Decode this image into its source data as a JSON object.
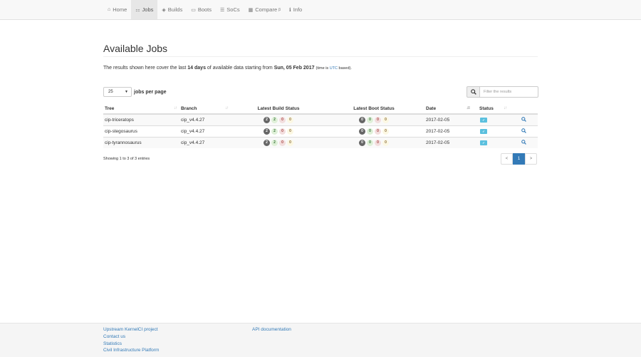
{
  "nav": {
    "items": [
      {
        "label": "Home",
        "icon": "home-icon",
        "glyph": "⌂",
        "active": false
      },
      {
        "label": "Jobs",
        "icon": "sitemap-icon",
        "glyph": "⚏",
        "active": true
      },
      {
        "label": "Builds",
        "icon": "cubes-icon",
        "glyph": "◈",
        "active": false
      },
      {
        "label": "Boots",
        "icon": "hdd-icon",
        "glyph": "▭",
        "active": false
      },
      {
        "label": "SoCs",
        "icon": "list-icon",
        "glyph": "☰",
        "active": false
      },
      {
        "label": "Compare",
        "icon": "grid-icon",
        "glyph": "▦",
        "active": false,
        "sup": "β"
      },
      {
        "label": "Info",
        "icon": "info-icon",
        "glyph": "ℹ",
        "active": false
      }
    ]
  },
  "page": {
    "title": "Available Jobs",
    "desc": {
      "p1": "The results shown here cover the last ",
      "days": "14 days",
      "p2": " of available data starting from ",
      "date": "Sun, 05 Feb 2017",
      "note_pre": "(time is ",
      "note_link": "UTC",
      "note_post": " based)."
    }
  },
  "controls": {
    "page_size": "25",
    "page_size_label": "jobs per page",
    "search_placeholder": "Filter the results"
  },
  "table": {
    "headers": {
      "tree": "Tree",
      "branch": "Branch",
      "build": "Latest Build Status",
      "boot": "Latest Boot Status",
      "date": "Date",
      "status": "Status"
    },
    "rows": [
      {
        "tree": "cip-triceratops",
        "branch": "cip_v4.4.27",
        "build": [
          "2",
          "2",
          "0",
          "0"
        ],
        "boot": [
          "0",
          "0",
          "0",
          "0"
        ],
        "date": "2017-02-05",
        "status": "✓"
      },
      {
        "tree": "cip-stegosaurus",
        "branch": "cip_v4.4.27",
        "build": [
          "2",
          "2",
          "0",
          "0"
        ],
        "boot": [
          "0",
          "0",
          "0",
          "0"
        ],
        "date": "2017-02-05",
        "status": "✓"
      },
      {
        "tree": "cip-tyrannosaurus",
        "branch": "cip_v4.4.27",
        "build": [
          "2",
          "2",
          "0",
          "0"
        ],
        "boot": [
          "0",
          "0",
          "0",
          "0"
        ],
        "date": "2017-02-05",
        "status": "✓"
      }
    ]
  },
  "pagination": {
    "info": "Showing 1 to 3 of 3 entries",
    "prev": "<",
    "current": "1",
    "next": ">"
  },
  "footer": {
    "col1": [
      "Upstream KernelCI project",
      "Contact us",
      "Statistics",
      "Civil Infrastructure Platform"
    ],
    "col2": [
      "API documentation"
    ]
  }
}
